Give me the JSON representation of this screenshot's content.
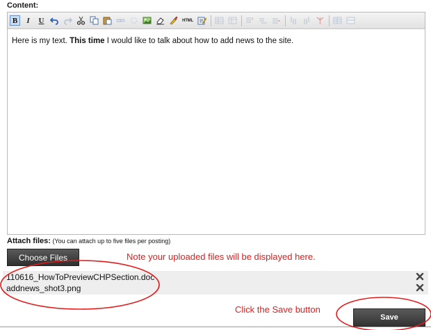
{
  "content_label": "Content:",
  "toolbar": {
    "bold": "B",
    "italic": "I",
    "underline": "U",
    "html": "HTML"
  },
  "editor": {
    "text_before": "Here is my text.  ",
    "text_bold": "This time",
    "text_after": " I would like to talk about how to add news to the site."
  },
  "attach": {
    "label": "Attach files:",
    "hint": " (You can attach up to five files per posting)"
  },
  "choose_button": "Choose Files",
  "note": "Note your uploaded files will be displayed here.",
  "files": [
    {
      "name": "110616_HowToPreviewCHPSection.doc"
    },
    {
      "name": "addnews_shot3.png"
    }
  ],
  "save_hint": "Click the Save button",
  "save_button": "Save",
  "colors": {
    "annotation": "#e41b1b",
    "button": "#3a3a3a"
  }
}
